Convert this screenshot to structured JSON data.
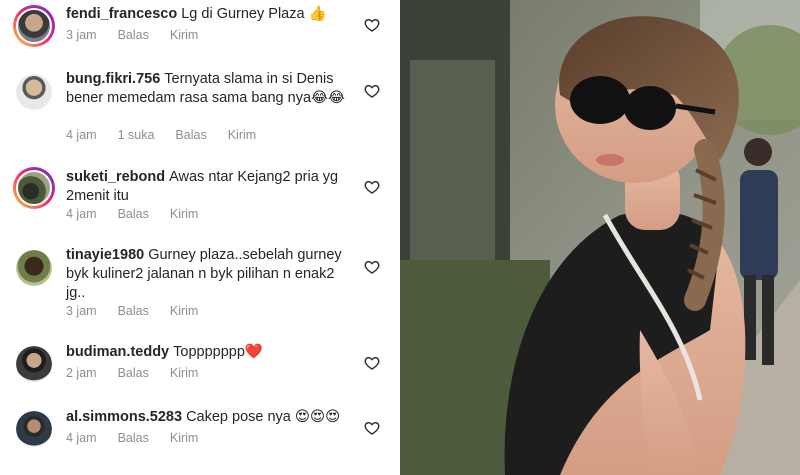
{
  "comments": [
    {
      "username": "fendi_francesco",
      "text": "Lg di Gurney Plaza 👍",
      "time": "3 jam",
      "reply_label": "Balas",
      "send_label": "Kirim"
    },
    {
      "username": "bung.fikri.756",
      "text": "Ternyata slama in si Denis bener memedam rasa sama bang nya😂😂",
      "time": "4 jam",
      "likes": "1 suka",
      "reply_label": "Balas",
      "send_label": "Kirim"
    },
    {
      "username": "suketi_rebond",
      "text": "Awas ntar Kejang2 pria yg 2menit itu",
      "time": "4 jam",
      "reply_label": "Balas",
      "send_label": "Kirim"
    },
    {
      "username": "tinayie1980",
      "text": "Gurney plaza..sebelah gurney byk kuliner2 jalanan n byk pilihan n enak2 jg..",
      "time": "3 jam",
      "reply_label": "Balas",
      "send_label": "Kirim"
    },
    {
      "username": "budiman.teddy",
      "text": "Toppppppp❤️",
      "time": "2 jam",
      "reply_label": "Balas",
      "send_label": "Kirim"
    },
    {
      "username": "al.simmons.5283",
      "text": "Cakep pose nya 😍😍😍",
      "time": "4 jam",
      "reply_label": "Balas",
      "send_label": "Kirim"
    }
  ],
  "colors": {
    "text": "#262626",
    "meta": "#8e8e8e",
    "story_ring": [
      "#f9ce34",
      "#ee2a7b",
      "#6228d7"
    ]
  }
}
